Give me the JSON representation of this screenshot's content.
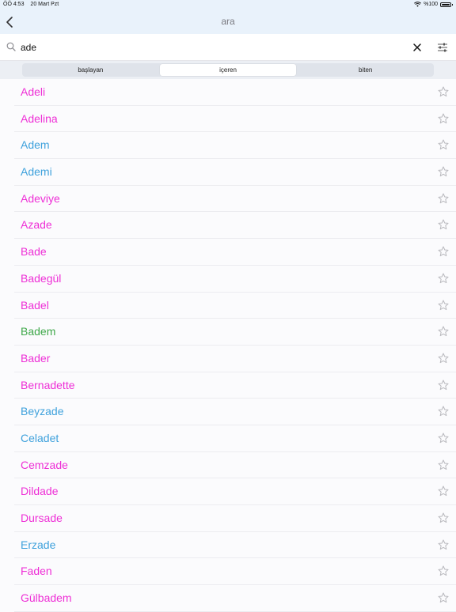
{
  "status": {
    "time": "ÖÖ 4:53",
    "date": "20 Mart Pzt",
    "battery": "%100"
  },
  "nav": {
    "title": "ara",
    "back_icon": "chevron-left-icon"
  },
  "search": {
    "value": "ade",
    "placeholder": ""
  },
  "segments": [
    {
      "label": "başlayan",
      "active": false
    },
    {
      "label": "içeren",
      "active": true
    },
    {
      "label": "biten",
      "active": false
    }
  ],
  "colors": {
    "pink": "#ee2fd6",
    "blue": "#3ea1dc",
    "green": "#3fa84a",
    "star": "#b9b9be",
    "nav_bg": "#e9f2fb"
  },
  "names": [
    {
      "name": "Adeli",
      "color": "#ee2fd6"
    },
    {
      "name": "Adelina",
      "color": "#ee2fd6"
    },
    {
      "name": "Adem",
      "color": "#3ea1dc"
    },
    {
      "name": "Ademi",
      "color": "#3ea1dc"
    },
    {
      "name": "Adeviye",
      "color": "#ee2fd6"
    },
    {
      "name": "Azade",
      "color": "#ee2fd6"
    },
    {
      "name": "Bade",
      "color": "#ee2fd6"
    },
    {
      "name": "Badegül",
      "color": "#ee2fd6"
    },
    {
      "name": "Badel",
      "color": "#ee2fd6"
    },
    {
      "name": "Badem",
      "color": "#3fa84a"
    },
    {
      "name": "Bader",
      "color": "#ee2fd6"
    },
    {
      "name": "Bernadette",
      "color": "#ee2fd6"
    },
    {
      "name": "Beyzade",
      "color": "#3ea1dc"
    },
    {
      "name": "Celadet",
      "color": "#3ea1dc"
    },
    {
      "name": "Cemzade",
      "color": "#ee2fd6"
    },
    {
      "name": "Dildade",
      "color": "#ee2fd6"
    },
    {
      "name": "Dursade",
      "color": "#ee2fd6"
    },
    {
      "name": "Erzade",
      "color": "#3ea1dc"
    },
    {
      "name": "Faden",
      "color": "#ee2fd6"
    },
    {
      "name": "Gülbadem",
      "color": "#ee2fd6"
    }
  ]
}
